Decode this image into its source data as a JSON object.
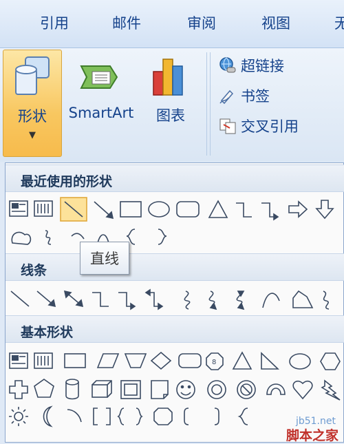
{
  "ribbon_tabs": [
    "引用",
    "邮件",
    "审阅",
    "视图"
  ],
  "insert": {
    "shapes_label": "形状",
    "smartart_label": "SmartArt",
    "chart_label": "图表",
    "hyperlink_label": "超链接",
    "bookmark_label": "书签",
    "crossref_label": "交叉引用"
  },
  "gallery": {
    "recent_title": "最近使用的形状",
    "lines_title": "线条",
    "basic_title": "基本形状",
    "tooltip": "直线"
  },
  "watermark": {
    "site": "jb51.net",
    "name": "脚本之家"
  },
  "colors": {
    "accent": "#f8c760",
    "tab_text": "#15428b"
  }
}
